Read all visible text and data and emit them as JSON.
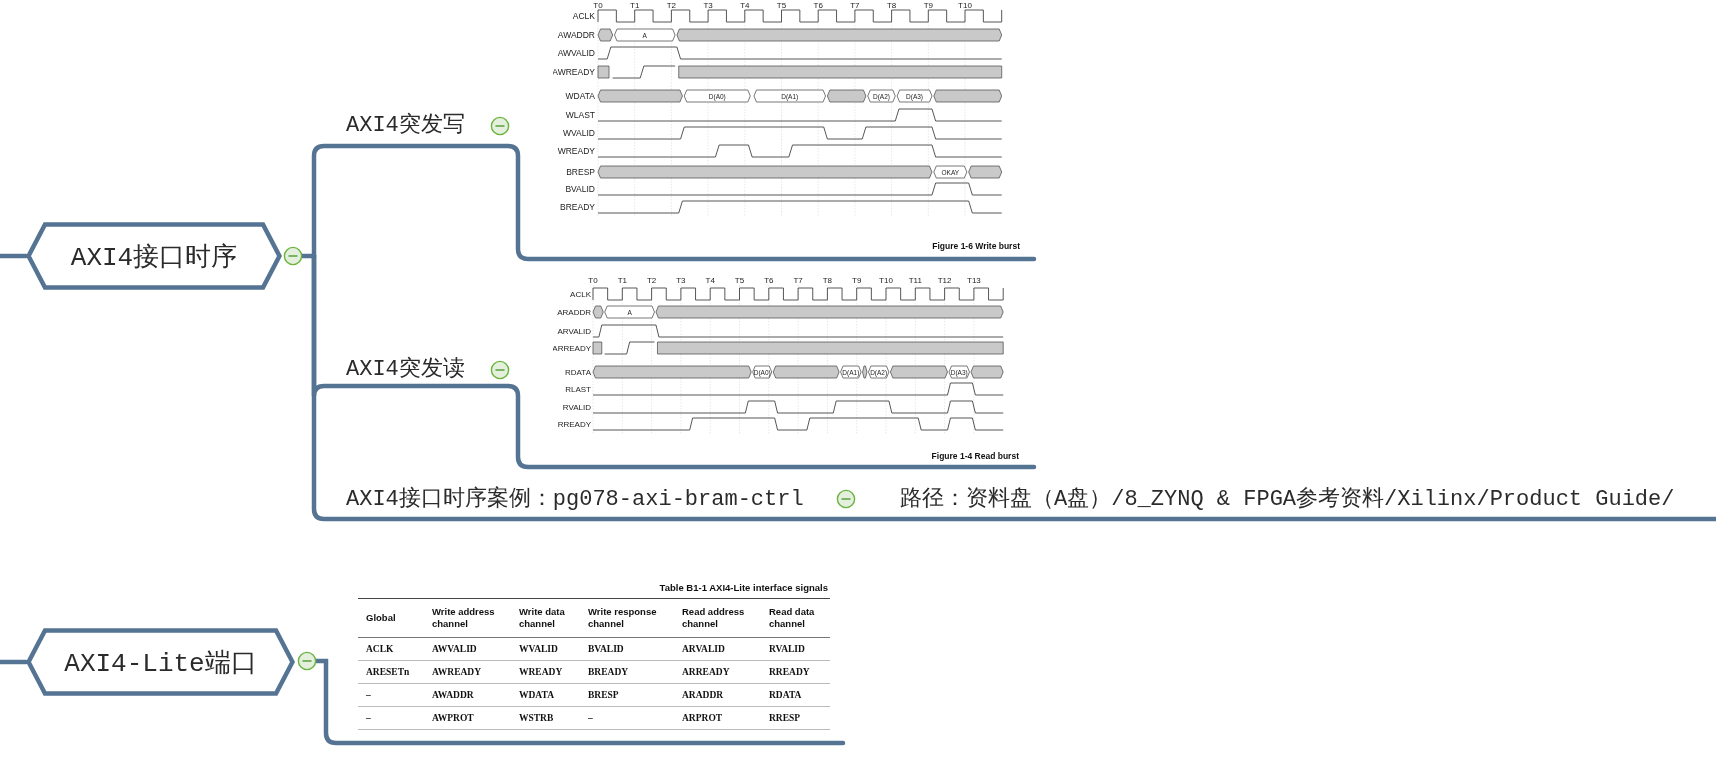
{
  "map": {
    "topics": [
      {
        "title": "AXI4接口时序",
        "expanded": true,
        "children": [
          {
            "title": "AXI4突发写",
            "expanded": true,
            "figure": {
              "time_labels": [
                "T0",
                "T1",
                "T2",
                "T3",
                "T4",
                "T5",
                "T6",
                "T7",
                "T8",
                "T9",
                "T10"
              ],
              "signals": [
                {
                  "name": "ACLK",
                  "kind": "clock"
                },
                {
                  "name": "AWADDR",
                  "kind": "bus",
                  "labels": [
                    "A"
                  ]
                },
                {
                  "name": "AWVALID",
                  "kind": "line"
                },
                {
                  "name": "AWREADY",
                  "kind": "line"
                },
                {
                  "name": "WDATA",
                  "kind": "bus",
                  "labels": [
                    "D(A0)",
                    "D(A1)",
                    "D(A2)",
                    "D(A3)"
                  ]
                },
                {
                  "name": "WLAST",
                  "kind": "line"
                },
                {
                  "name": "WVALID",
                  "kind": "line"
                },
                {
                  "name": "WREADY",
                  "kind": "line"
                },
                {
                  "name": "BRESP",
                  "kind": "bus",
                  "labels": [
                    "OKAY"
                  ]
                },
                {
                  "name": "BVALID",
                  "kind": "line"
                },
                {
                  "name": "BREADY",
                  "kind": "line"
                }
              ],
              "caption": "Figure 1-6 Write burst"
            }
          },
          {
            "title": "AXI4突发读",
            "expanded": true,
            "figure": {
              "time_labels": [
                "T0",
                "T1",
                "T2",
                "T3",
                "T4",
                "T5",
                "T6",
                "T7",
                "T8",
                "T9",
                "T10",
                "T11",
                "T12",
                "T13"
              ],
              "signals": [
                {
                  "name": "ACLK",
                  "kind": "clock"
                },
                {
                  "name": "ARADDR",
                  "kind": "bus",
                  "labels": [
                    "A"
                  ]
                },
                {
                  "name": "ARVALID",
                  "kind": "line"
                },
                {
                  "name": "ARREADY",
                  "kind": "line"
                },
                {
                  "name": "RDATA",
                  "kind": "bus",
                  "labels": [
                    "D(A0)",
                    "D(A1)",
                    "D(A2)",
                    "D(A3)"
                  ]
                },
                {
                  "name": "RLAST",
                  "kind": "line"
                },
                {
                  "name": "RVALID",
                  "kind": "line"
                },
                {
                  "name": "RREADY",
                  "kind": "line"
                }
              ],
              "caption": "Figure 1-4 Read burst"
            }
          },
          {
            "title": "AXI4接口时序案例：pg078-axi-bram-ctrl",
            "expanded": true,
            "children": [
              {
                "title": "路径：资料盘（A盘）/8_ZYNQ & FPGA参考资料/Xilinx/Product Guide/"
              }
            ]
          }
        ]
      },
      {
        "title": "AXI4-Lite端口",
        "expanded": true,
        "table": {
          "title": "Table B1-1 AXI4-Lite interface signals",
          "columns": [
            "Global",
            "Write address channel",
            "Write data channel",
            "Write response channel",
            "Read address channel",
            "Read data channel"
          ],
          "rows": [
            [
              "ACLK",
              "AWVALID",
              "WVALID",
              "BVALID",
              "ARVALID",
              "RVALID"
            ],
            [
              "ARESETn",
              "AWREADY",
              "WREADY",
              "BREADY",
              "ARREADY",
              "RREADY"
            ],
            [
              "–",
              "AWADDR",
              "WDATA",
              "BRESP",
              "ARADDR",
              "RDATA"
            ],
            [
              "–",
              "AWPROT",
              "WSTRB",
              "–",
              "ARPROT",
              "RRESP"
            ]
          ]
        }
      }
    ]
  }
}
